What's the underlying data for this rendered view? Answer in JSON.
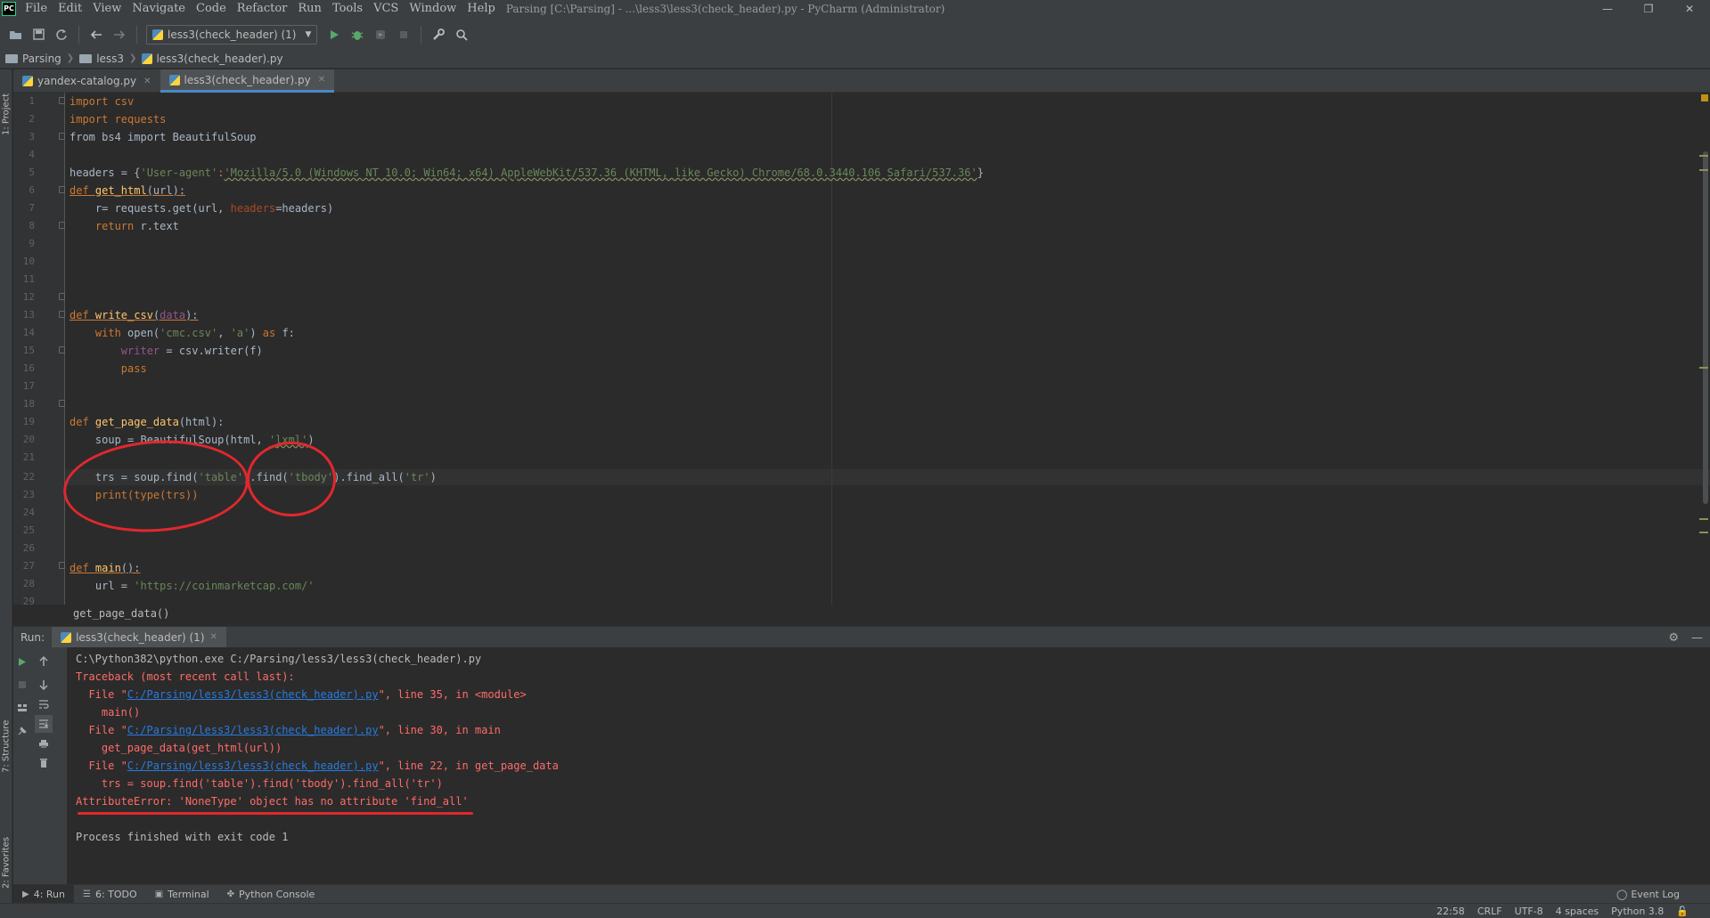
{
  "window": {
    "app_logo": "PC",
    "title": "Parsing [C:\\Parsing] - ...\\less3\\less3(check_header).py - PyCharm (Administrator)",
    "menu": [
      "File",
      "Edit",
      "View",
      "Navigate",
      "Code",
      "Refactor",
      "Run",
      "Tools",
      "VCS",
      "Window",
      "Help"
    ],
    "controls": {
      "minimize": "—",
      "maximize": "❐",
      "close": "✕"
    }
  },
  "toolbar": {
    "run_config": "less3(check_header) (1)"
  },
  "breadcrumb": [
    "Parsing",
    "less3",
    "less3(check_header).py"
  ],
  "left_strip": {
    "project": "1: Project",
    "structure": "7: Structure",
    "favorites": "2: Favorites"
  },
  "editor_tabs": [
    {
      "label": "yandex-catalog.py",
      "active": false
    },
    {
      "label": "less3(check_header).py",
      "active": true
    }
  ],
  "editor": {
    "line_numbers": [
      "1",
      "2",
      "3",
      "4",
      "5",
      "6",
      "7",
      "8",
      "9",
      "10",
      "11",
      "12",
      "13",
      "14",
      "15",
      "16",
      "17",
      "18",
      "19",
      "20",
      "21",
      "22",
      "23",
      "24",
      "25",
      "26",
      "27",
      "28",
      "29"
    ],
    "lines": {
      "l1": "import csv",
      "l2": "import requests",
      "l3": "from bs4 import BeautifulSoup",
      "l5_a": "headers = {",
      "l5_b": "'User-agent'",
      "l5_c": ":",
      "l5_d": "'Mozilla/5.0 (Windows NT 10.0; Win64; x64) AppleWebKit/537.36 (KHTML, like Gecko) Chrome/68.0.3440.106 Safari/537.36'",
      "l5_e": "}",
      "l6_def": "def ",
      "l6_name": "get_html",
      "l6_rest": "(url):",
      "l7_a": "    r= requests.get(url, ",
      "l7_b": "headers",
      "l7_c": "=headers)",
      "l8_kw": "    return ",
      "l8_rest": "r.text",
      "l12_def": "def ",
      "l12_name": "write_csv",
      "l12_open": "(",
      "l12_param": "data",
      "l12_close": "):",
      "l13_kw": "    with ",
      "l13_a": "open(",
      "l13_s1": "'cmc.csv'",
      "l13_b": ", ",
      "l13_s2": "'a'",
      "l13_c": ") ",
      "l13_as": "as",
      "l13_d": " f:",
      "l14_a": "        writer",
      "l14_b": " = csv.writer(f)",
      "l15": "        pass",
      "l18_def": "def ",
      "l18_name": "get_page_data",
      "l18_rest": "(html):",
      "l19_a": "    soup = BeautifulSoup(html, ",
      "l19_s": "'lxml'",
      "l19_b": ")",
      "l22_a": "    trs = soup.find(",
      "l22_s1": "'table'",
      "l22_b": ").find(",
      "l22_s2": "'tbody'",
      "l22_c": ").find_all(",
      "l22_s3": "'tr'",
      "l22_d": ")",
      "l23": "    print(type(trs))",
      "l28_def": "def ",
      "l28_name": "main",
      "l28_rest": "():",
      "l29_a": "    url = ",
      "l29_s": "'https://coinmarketcap.com/'"
    },
    "hint": "get_page_data()"
  },
  "run_panel": {
    "label": "Run:",
    "tab": "less3(check_header) (1)",
    "console": {
      "c1": "C:\\Python382\\python.exe C:/Parsing/less3/less3(check_header).py",
      "c2": "Traceback (most recent call last):",
      "c3_a": "  File \"",
      "c3_link": "C:/Parsing/less3/less3(check_header).py",
      "c3_b": "\", line 35, in <module>",
      "c4": "    main()",
      "c5_a": "  File \"",
      "c5_link": "C:/Parsing/less3/less3(check_header).py",
      "c5_b": "\", line 30, in main",
      "c6": "    get_page_data(get_html(url))",
      "c7_a": "  File \"",
      "c7_link": "C:/Parsing/less3/less3(check_header).py",
      "c7_b": "\", line 22, in get_page_data",
      "c8": "    trs = soup.find('table').find('tbody').find_all('tr')",
      "c9": "AttributeError: 'NoneType' object has no attribute 'find_all'",
      "c10": "Process finished with exit code 1"
    }
  },
  "bottom_tabs": [
    {
      "label": "4: Run",
      "icon": "▶"
    },
    {
      "label": "6: TODO",
      "icon": "☰"
    },
    {
      "label": "Terminal",
      "icon": "▣"
    },
    {
      "label": "Python Console",
      "icon": "✤"
    }
  ],
  "event_log": "Event Log",
  "status_bar": {
    "position": "22:58",
    "line_sep": "CRLF",
    "encoding": "UTF-8",
    "indent": "4 spaces",
    "interpreter": "Python 3.8"
  },
  "colors": {
    "annotation": "#e0282d",
    "keyword": "#cc7832",
    "string": "#6a8759",
    "function": "#ffc66d",
    "error": "#ff6b68",
    "link": "#287bde"
  },
  "icons": [
    "pycharm-logo-icon",
    "open-folder-icon",
    "save-icon",
    "sync-icon",
    "back-arrow-icon",
    "forward-arrow-icon",
    "run-icon",
    "debug-icon",
    "coverage-icon",
    "stop-icon",
    "wrench-icon",
    "search-icon",
    "gear-icon",
    "minimize-icon"
  ]
}
